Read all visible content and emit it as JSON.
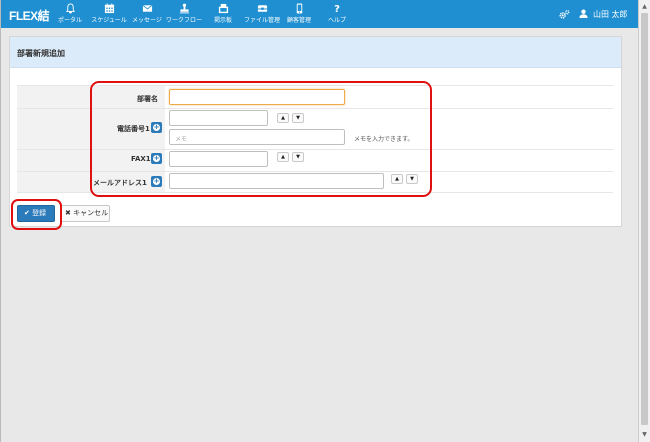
{
  "app": {
    "logo": "FLEX結"
  },
  "nav": {
    "items": [
      {
        "label": "ポータル",
        "icon": "bell-icon"
      },
      {
        "label": "スケジュール",
        "icon": "calendar-icon"
      },
      {
        "label": "メッセージ",
        "icon": "envelope-icon"
      },
      {
        "label": "ワークフロー",
        "icon": "stamp-icon"
      },
      {
        "label": "掲示板",
        "icon": "board-icon"
      },
      {
        "label": "ファイル管理",
        "icon": "folder-icon"
      },
      {
        "label": "顧客管理",
        "icon": "phone-book-icon"
      },
      {
        "label": "ヘルプ",
        "icon": "question-icon"
      }
    ],
    "user_name": "山田 太郎"
  },
  "panel": {
    "title": "部署新規追加"
  },
  "form": {
    "dept_name_label": "部署名",
    "phone_label": "電話番号1",
    "memo_placeholder": "メモ",
    "memo_hint": "メモを入力できます。",
    "fax_label": "FAX1",
    "email_label": "メールアドレス1",
    "arrow_up": "▲",
    "arrow_down": "▼"
  },
  "buttons": {
    "register": "登録",
    "cancel": "キャンセル"
  },
  "colors": {
    "navbar": "#1f8fd1",
    "panel_header": "#dcebfa",
    "primary": "#2b7ab9",
    "highlight": "#e01010",
    "focus": "#f0a948"
  }
}
